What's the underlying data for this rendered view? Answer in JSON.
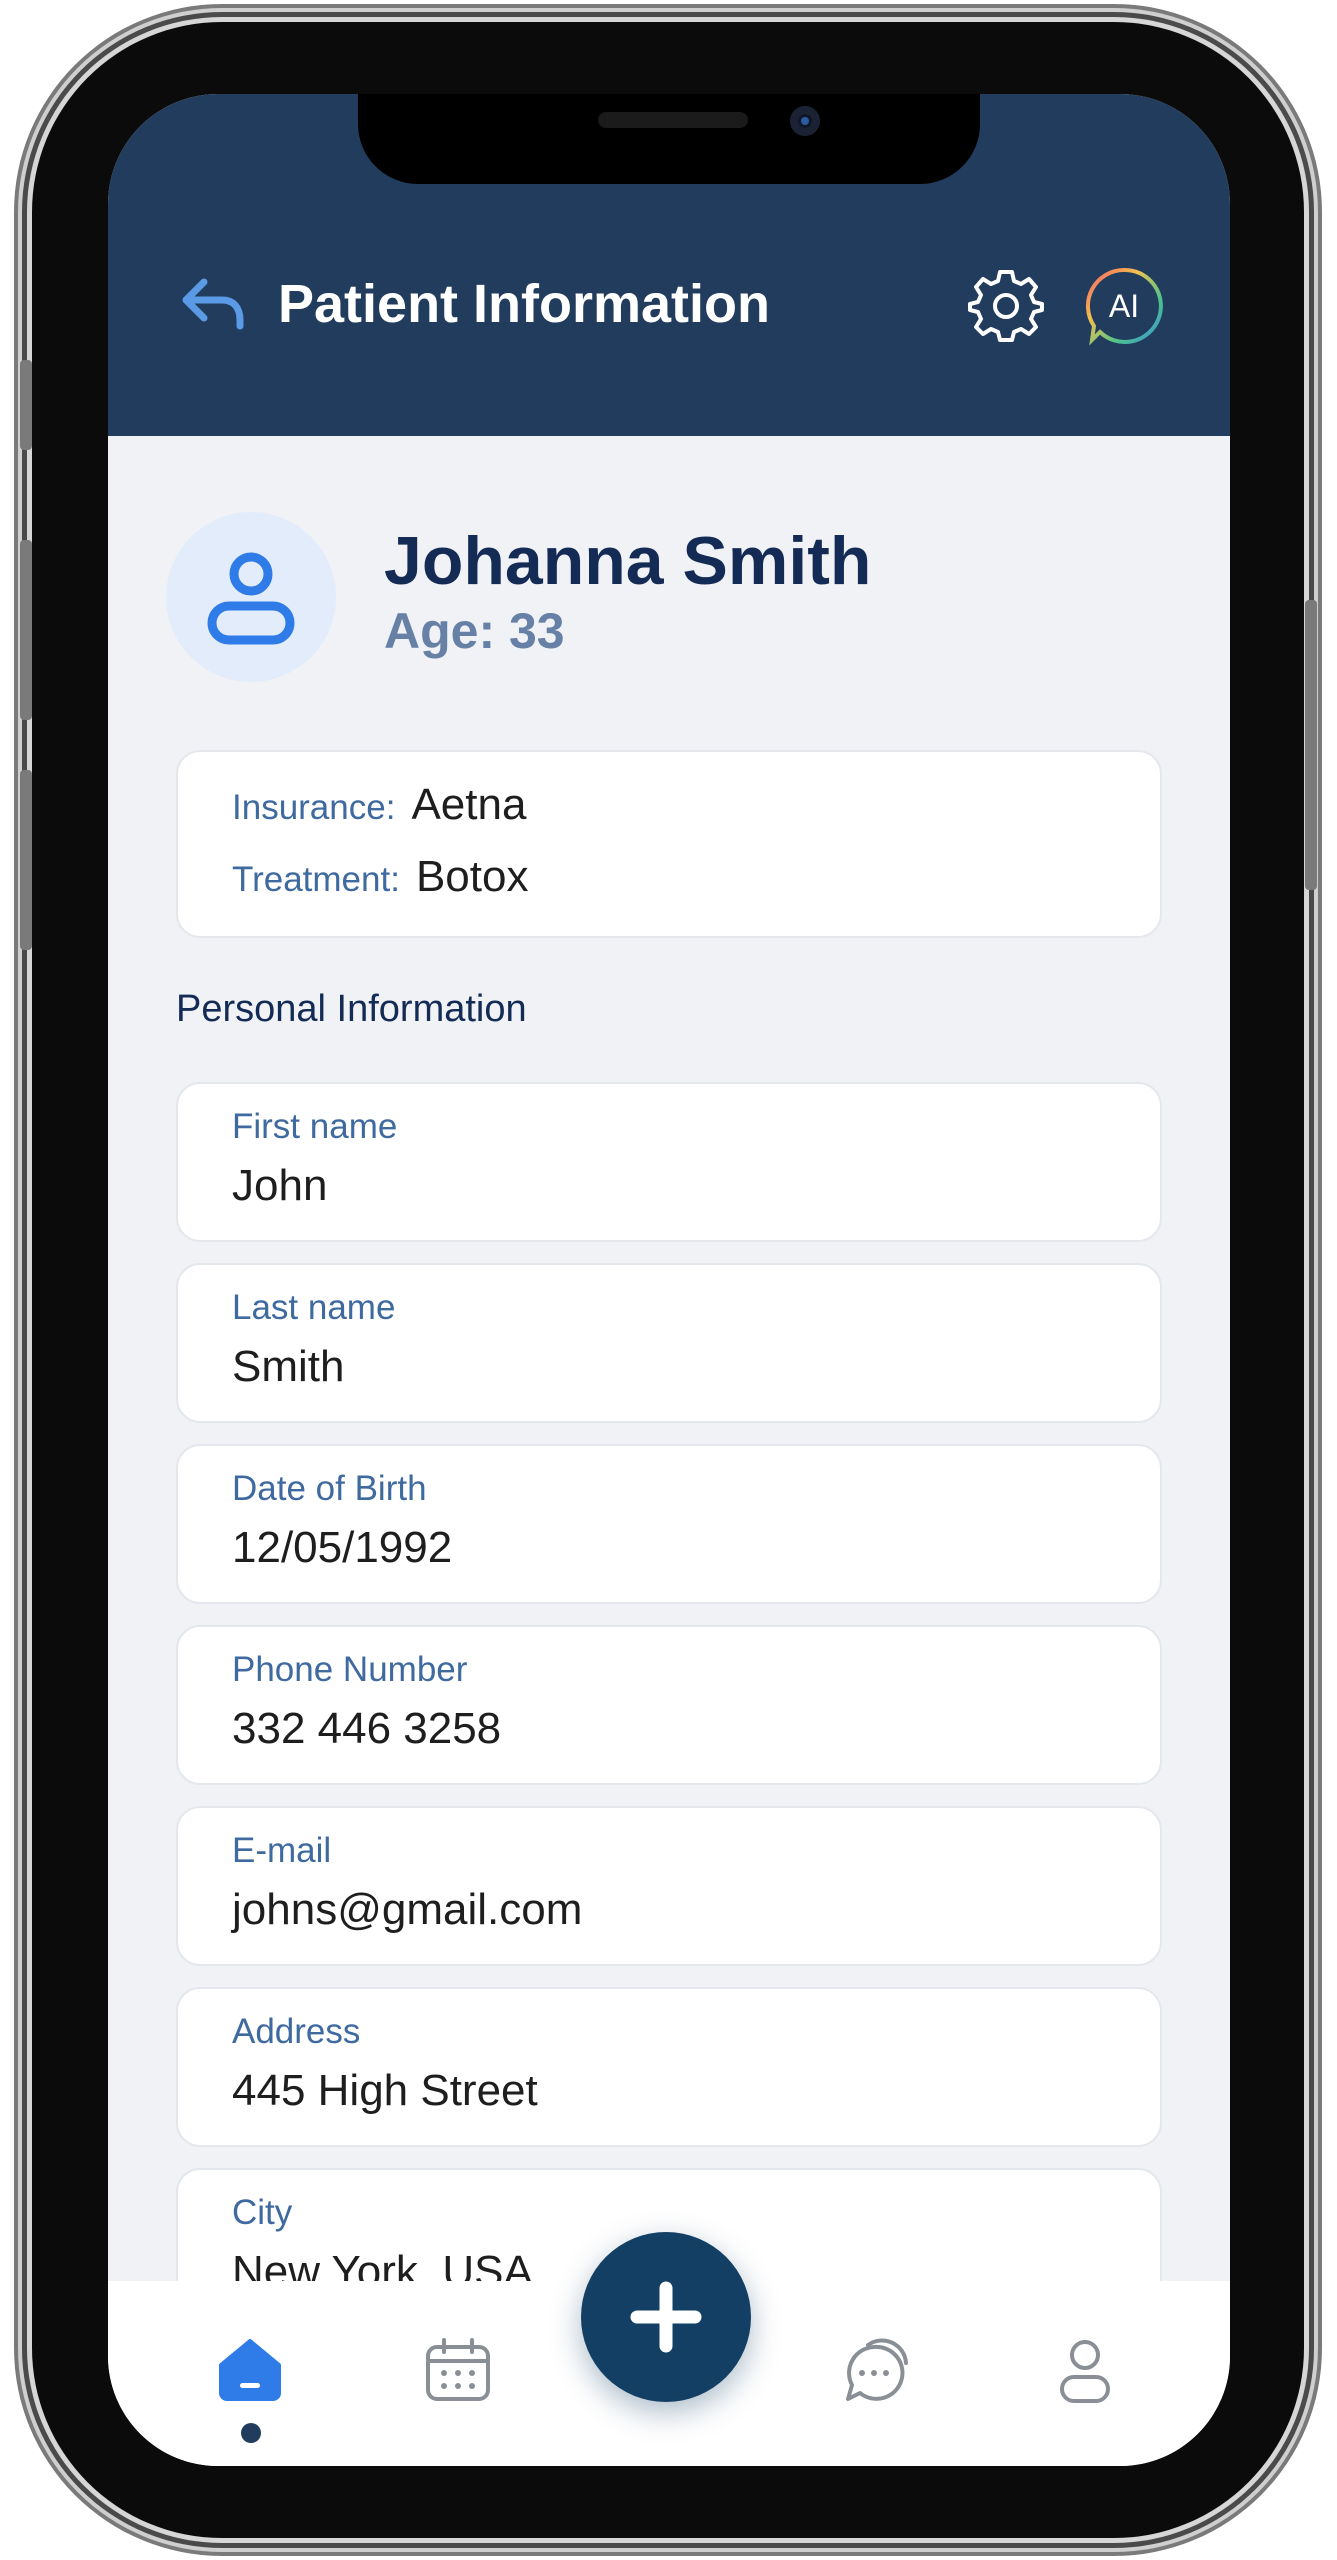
{
  "header": {
    "title": "Patient Information",
    "ai_label": "AI",
    "bg_color": "#213c5c"
  },
  "patient": {
    "name": "Johanna Smith",
    "age": "Age: 33"
  },
  "summary": {
    "insurance_label": "Insurance:",
    "insurance_value": "Aetna",
    "treatment_label": "Treatment:",
    "treatment_value": "Botox"
  },
  "section_title": "Personal Information",
  "fields": [
    {
      "label": "First name",
      "value": "John"
    },
    {
      "label": "Last name",
      "value": "Smith"
    },
    {
      "label": "Date of Birth",
      "value": "12/05/1992"
    },
    {
      "label": "Phone Number",
      "value": "332 446 3258"
    },
    {
      "label": "E-mail",
      "value": "johns@gmail.com"
    },
    {
      "label": "Address",
      "value": "445 High Street"
    },
    {
      "label": "City",
      "value": "New York, USA"
    }
  ],
  "nav": {
    "items": [
      "home-icon",
      "calendar-icon",
      "add-icon",
      "chat-icon",
      "profile-icon"
    ],
    "active": "home-icon",
    "accent_color": "#2f7be8",
    "fab_color": "#123f63"
  }
}
